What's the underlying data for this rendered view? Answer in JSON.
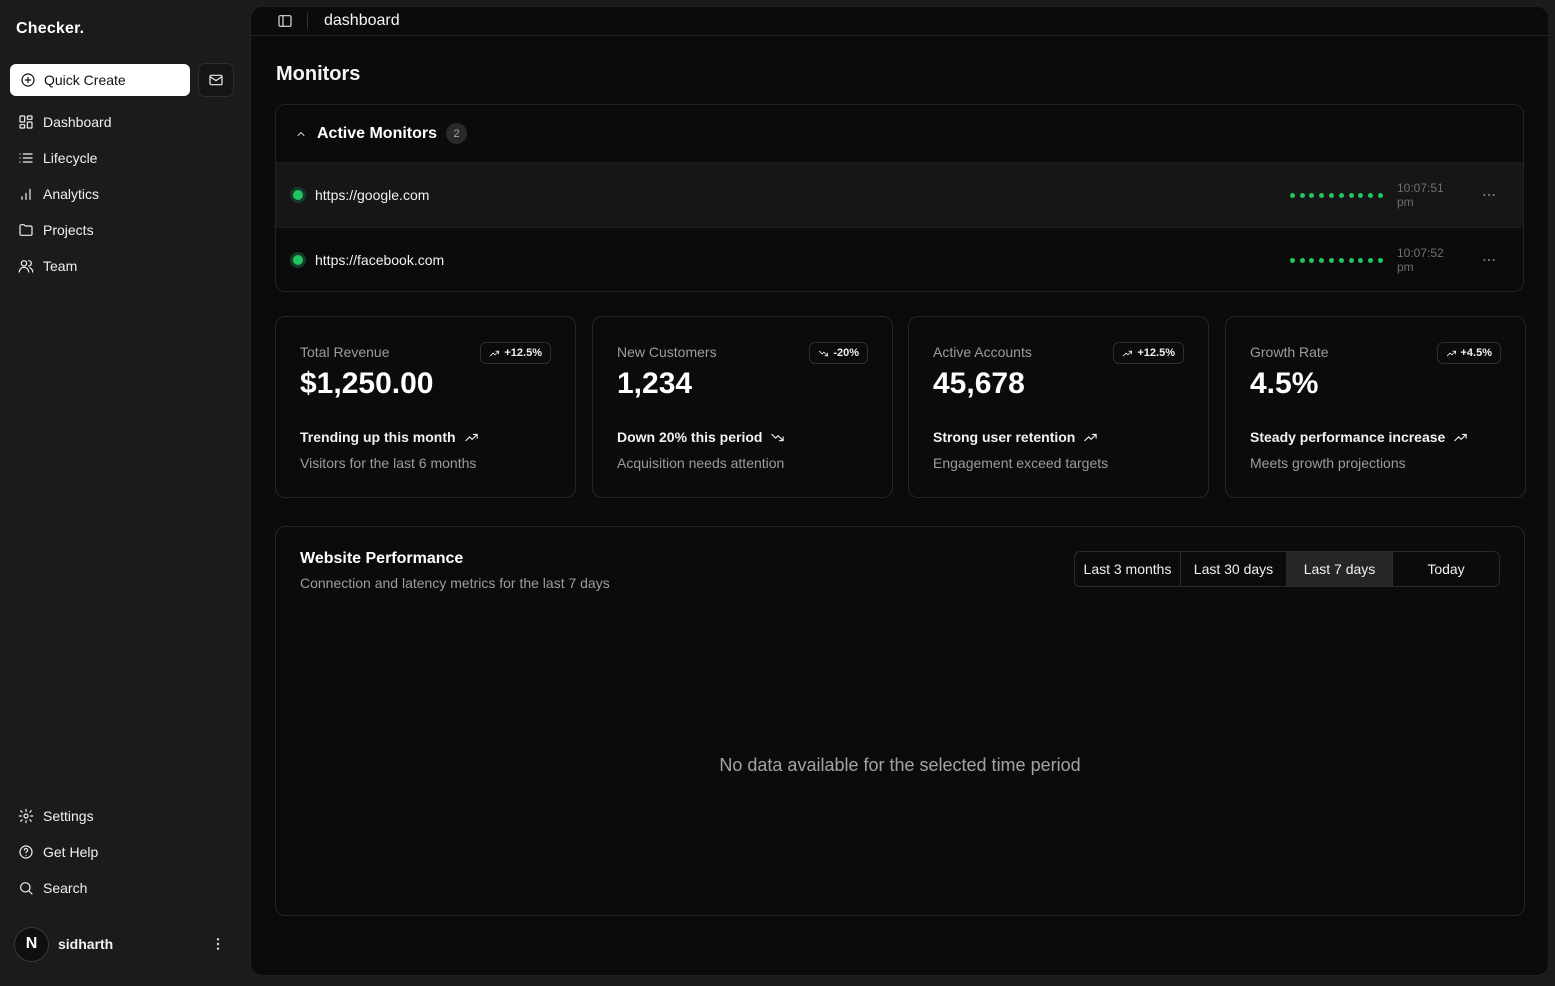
{
  "brand": "Checker.",
  "sidebar": {
    "quick_create": "Quick Create",
    "nav_top": [
      {
        "label": "Dashboard",
        "icon": "dashboard-icon"
      },
      {
        "label": "Lifecycle",
        "icon": "list-icon"
      },
      {
        "label": "Analytics",
        "icon": "bar-chart-icon"
      },
      {
        "label": "Projects",
        "icon": "folder-icon"
      },
      {
        "label": "Team",
        "icon": "users-icon"
      }
    ],
    "nav_bottom": [
      {
        "label": "Settings",
        "icon": "gear-icon"
      },
      {
        "label": "Get Help",
        "icon": "help-circle-icon"
      },
      {
        "label": "Search",
        "icon": "search-icon"
      }
    ],
    "user": {
      "initial": "N",
      "name": "sidharth"
    }
  },
  "topbar": {
    "title": "dashboard"
  },
  "main": {
    "section_title": "Monitors",
    "monitors": {
      "label": "Active Monitors",
      "count": "2",
      "items": [
        {
          "url": "https://google.com",
          "time": "10:07:51 pm",
          "pings": 10
        },
        {
          "url": "https://facebook.com",
          "time": "10:07:52 pm",
          "pings": 10
        }
      ]
    },
    "stats": [
      {
        "label": "Total Revenue",
        "badge": "+12.5%",
        "direction": "up",
        "value": "$1,250.00",
        "trend": "Trending up this month",
        "sub": "Visitors for the last 6 months"
      },
      {
        "label": "New Customers",
        "badge": "-20%",
        "direction": "down",
        "value": "1,234",
        "trend": "Down 20% this period",
        "sub": "Acquisition needs attention"
      },
      {
        "label": "Active Accounts",
        "badge": "+12.5%",
        "direction": "up",
        "value": "45,678",
        "trend": "Strong user retention",
        "sub": "Engagement exceed targets"
      },
      {
        "label": "Growth Rate",
        "badge": "+4.5%",
        "direction": "up",
        "value": "4.5%",
        "trend": "Steady performance increase",
        "sub": "Meets growth projections"
      }
    ],
    "performance": {
      "title": "Website Performance",
      "subtitle": "Connection and latency metrics for the last 7 days",
      "ranges": [
        "Last 3 months",
        "Last 30 days",
        "Last 7 days",
        "Today"
      ],
      "selected_range": "Last 7 days",
      "empty_message": "No data available for the selected time period"
    }
  },
  "colors": {
    "status_green": "#22c55e",
    "background": "#0b0b0b",
    "sidebar": "#1b1b1b"
  }
}
